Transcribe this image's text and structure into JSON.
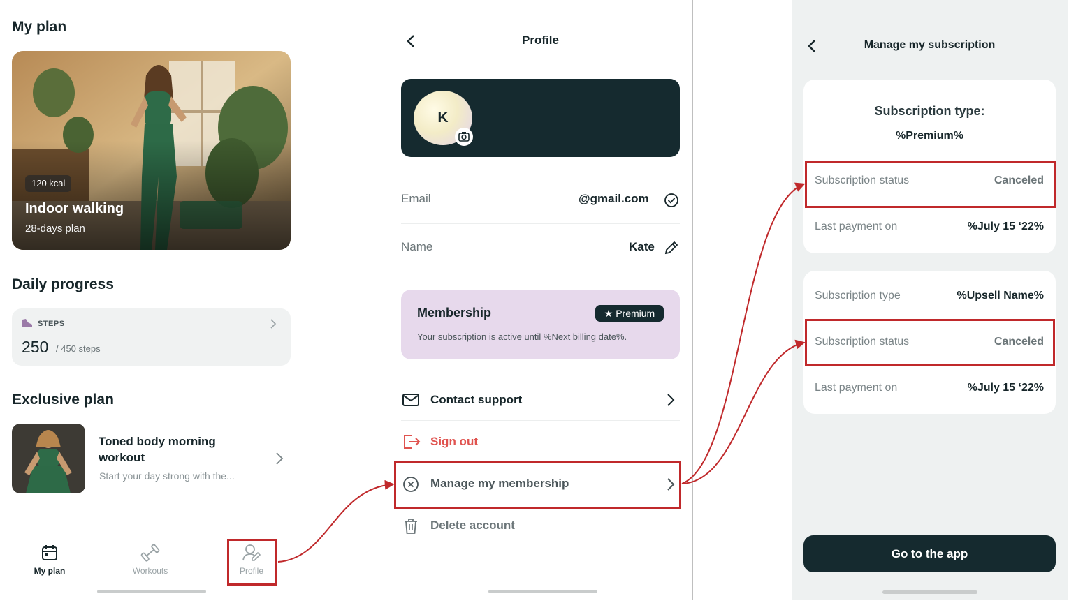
{
  "colors": {
    "dark": "#152a2f",
    "annotation": "#c0292b",
    "signout": "#e0534f",
    "membership_bg": "#e7d9ec"
  },
  "screen1": {
    "my_plan_heading": "My plan",
    "hero": {
      "kcal": "120 kcal",
      "title": "Indoor walking",
      "subtitle": "28-days plan"
    },
    "daily_progress_heading": "Daily progress",
    "steps": {
      "label": "STEPS",
      "value": "250",
      "goal": "/ 450 steps",
      "icon": "shoe-icon"
    },
    "exclusive_heading": "Exclusive plan",
    "exclusive": {
      "title": "Toned body morning workout",
      "description": "Start your day strong with the..."
    },
    "tabs": [
      {
        "label": "My plan",
        "icon": "calendar-icon",
        "active": true
      },
      {
        "label": "Workouts",
        "icon": "dumbbell-icon",
        "active": false
      },
      {
        "label": "Profile",
        "icon": "profile-icon",
        "active": false
      }
    ]
  },
  "screen2": {
    "title": "Profile",
    "avatar_initial": "K",
    "email_label": "Email",
    "email_value": "@gmail.com",
    "name_label": "Name",
    "name_value": "Kate",
    "membership": {
      "title": "Membership",
      "badge": "★ Premium",
      "description": "Your subscription is active until %Next billing date%."
    },
    "menu": [
      {
        "label": "Contact support",
        "icon": "mail-icon"
      },
      {
        "label": "Sign out",
        "icon": "sign-out-icon"
      },
      {
        "label": "Manage my membership",
        "icon": "cancel-circle-icon"
      },
      {
        "label": "Delete account",
        "icon": "trash-icon"
      }
    ]
  },
  "screen3": {
    "title": "Manage my subscription",
    "card1": {
      "heading": "Subscription type:",
      "type_value": "%Premium%",
      "status_label": "Subscription status",
      "status_value": "Canceled",
      "last_payment_label": "Last payment on",
      "last_payment_value": "%July 15 ‘22%"
    },
    "card2": {
      "type_label": "Subscription type",
      "type_value": "%Upsell Name%",
      "status_label": "Subscription status",
      "status_value": "Canceled",
      "last_payment_label": "Last payment on",
      "last_payment_value": "%July 15 ‘22%"
    },
    "button": "Go to the app"
  }
}
